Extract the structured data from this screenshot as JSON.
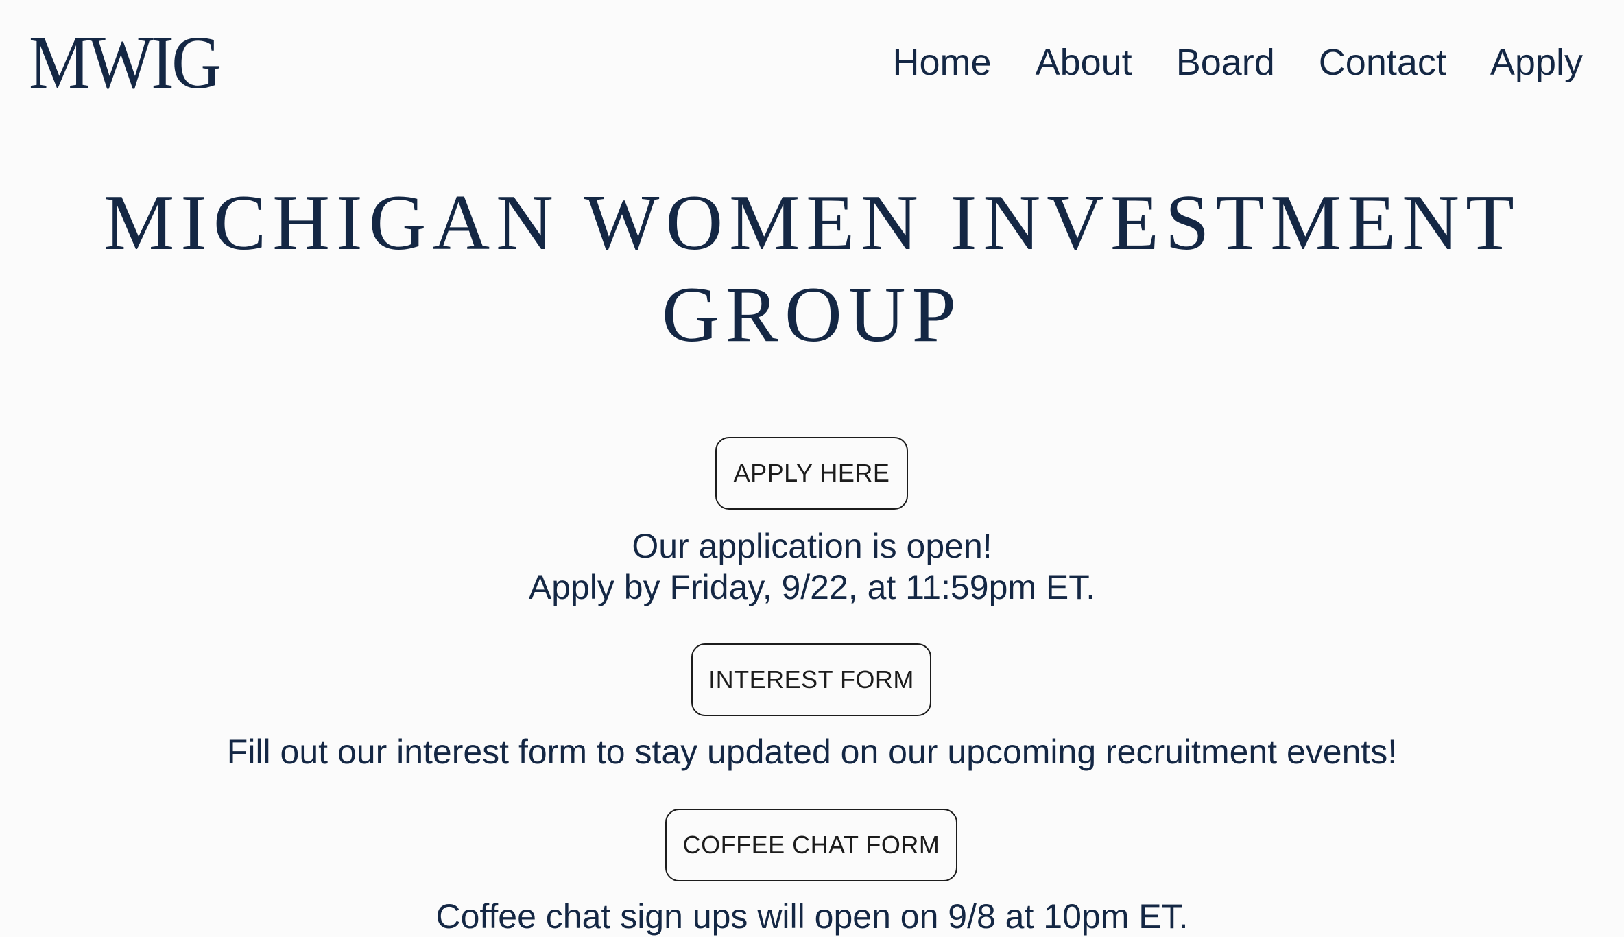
{
  "header": {
    "logo_text": "MWIG",
    "nav": [
      "Home",
      "About",
      "Board",
      "Contact",
      "Apply"
    ]
  },
  "hero": {
    "title_line1": "MICHIGAN WOMEN INVESTMENT",
    "title_line2": "GROUP"
  },
  "apply_section": {
    "button_label": "APPLY HERE",
    "line1": "Our application is open!",
    "line2": "Apply by Friday, 9/22, at 11:59pm ET."
  },
  "interest_section": {
    "button_label": "INTEREST FORM",
    "text": "Fill out our interest form to stay updated on our upcoming recruitment events!"
  },
  "coffee_section": {
    "button_label": "COFFEE CHAT FORM",
    "text": "Coffee chat sign ups will open on 9/8 at 10pm ET."
  },
  "colors": {
    "brand_navy": "#142744",
    "button_border": "#1c1c1c",
    "background": "#fbfbfb"
  }
}
